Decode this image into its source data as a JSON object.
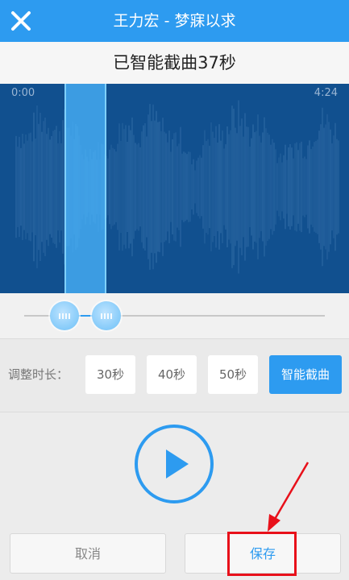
{
  "header": {
    "title": "王力宏 - 梦寐以求",
    "close_icon": "close-icon"
  },
  "status": {
    "text": "已智能截曲37秒"
  },
  "waveform": {
    "start_time": "0:00",
    "end_time": "4:24"
  },
  "duration": {
    "label": "调整时长：",
    "options": [
      {
        "label": "30秒",
        "selected": false
      },
      {
        "label": "40秒",
        "selected": false
      },
      {
        "label": "50秒",
        "selected": false
      },
      {
        "label": "智能截曲",
        "selected": true
      }
    ]
  },
  "player": {
    "play_icon": "play-icon"
  },
  "actions": {
    "cancel_label": "取消",
    "save_label": "保存"
  },
  "colors": {
    "accent": "#2d9bf0",
    "waveform_bg": "#11508f",
    "annotation": "#e8101a"
  }
}
